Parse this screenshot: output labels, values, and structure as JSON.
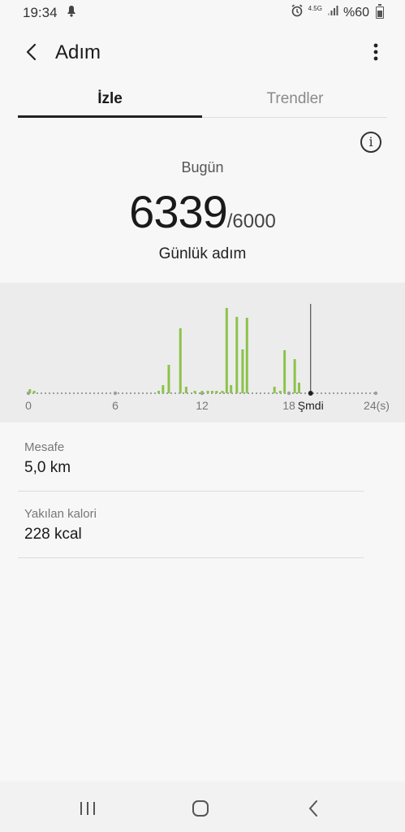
{
  "status_bar": {
    "time": "19:34",
    "network_label": "4.5G",
    "battery_text": "%60",
    "icons": [
      "notification-icon",
      "alarm-icon",
      "signal-icon",
      "battery-icon"
    ]
  },
  "header": {
    "title": "Adım",
    "back_icon": "back-arrow-icon",
    "more_icon": "more-vert-icon"
  },
  "tabs": [
    {
      "label": "İzle",
      "active": true
    },
    {
      "label": "Trendler",
      "active": false
    }
  ],
  "info_icon": "info-icon",
  "summary": {
    "day_label": "Bugün",
    "steps_value": "6339",
    "steps_goal": "/6000",
    "caption": "Günlük adım"
  },
  "chart_data": {
    "type": "bar",
    "x_tick_labels": [
      "0",
      "6",
      "12",
      "18",
      "24(s)"
    ],
    "now_label": "Şmdi",
    "now_hour": 19.5,
    "bar_color": "#8bc34a",
    "baseline_color": "#9e9e9e",
    "bars": [
      {
        "hour": 0.1,
        "value": 5
      },
      {
        "hour": 0.4,
        "value": 3
      },
      {
        "hour": 9.0,
        "value": 3
      },
      {
        "hour": 9.3,
        "value": 10
      },
      {
        "hour": 9.7,
        "value": 35
      },
      {
        "hour": 10.5,
        "value": 80
      },
      {
        "hour": 10.9,
        "value": 8
      },
      {
        "hour": 11.5,
        "value": 3
      },
      {
        "hour": 12.0,
        "value": 3
      },
      {
        "hour": 12.4,
        "value": 3
      },
      {
        "hour": 12.7,
        "value": 3
      },
      {
        "hour": 13.0,
        "value": 3
      },
      {
        "hour": 13.4,
        "value": 3
      },
      {
        "hour": 13.7,
        "value": 105
      },
      {
        "hour": 14.0,
        "value": 10
      },
      {
        "hour": 14.4,
        "value": 94
      },
      {
        "hour": 14.8,
        "value": 54
      },
      {
        "hour": 15.1,
        "value": 93
      },
      {
        "hour": 17.0,
        "value": 8
      },
      {
        "hour": 17.4,
        "value": 3
      },
      {
        "hour": 17.7,
        "value": 53
      },
      {
        "hour": 18.4,
        "value": 42
      },
      {
        "hour": 18.7,
        "value": 13
      }
    ],
    "ylim": [
      0,
      110
    ]
  },
  "stats": [
    {
      "label": "Mesafe",
      "value": "5,0 km"
    },
    {
      "label": "Yakılan kalori",
      "value": "228 kcal"
    }
  ],
  "nav_bar": {
    "icons": [
      "recent-apps-icon",
      "home-icon",
      "back-icon"
    ]
  }
}
